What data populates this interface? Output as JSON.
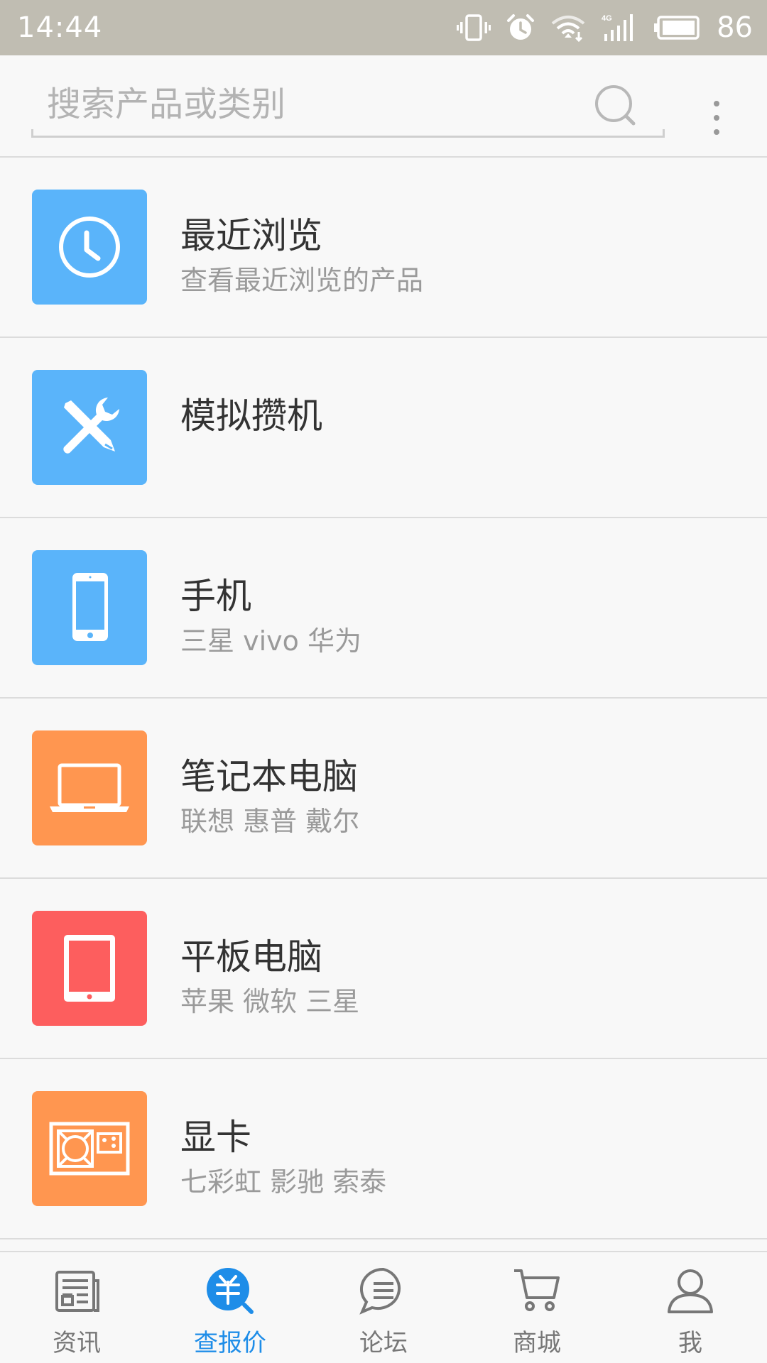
{
  "status_bar": {
    "time": "14:44",
    "battery": "86",
    "network": "4G"
  },
  "search": {
    "placeholder": "搜索产品或类别"
  },
  "list": [
    {
      "title": "最近浏览",
      "subtitle": "查看最近浏览的产品",
      "icon": "clock-icon",
      "color": "#5ab4fa"
    },
    {
      "title": "模拟攒机",
      "subtitle": "",
      "icon": "tools-icon",
      "color": "#5ab4fa"
    },
    {
      "title": "手机",
      "subtitle": "三星  vivo  华为",
      "icon": "phone-icon",
      "color": "#5ab4fa"
    },
    {
      "title": "笔记本电脑",
      "subtitle": "联想  惠普  戴尔",
      "icon": "laptop-icon",
      "color": "#ff9650"
    },
    {
      "title": "平板电脑",
      "subtitle": "苹果  微软  三星",
      "icon": "tablet-icon",
      "color": "#fd5e5e"
    },
    {
      "title": "显卡",
      "subtitle": "七彩虹  影驰  索泰",
      "icon": "graphics-card-icon",
      "color": "#ff9650"
    }
  ],
  "bottom_nav": {
    "active_color": "#1e8de8",
    "items": [
      {
        "label": "资讯",
        "icon": "news-icon"
      },
      {
        "label": "查报价",
        "icon": "price-icon"
      },
      {
        "label": "论坛",
        "icon": "forum-icon"
      },
      {
        "label": "商城",
        "icon": "cart-icon"
      },
      {
        "label": "我",
        "icon": "user-icon"
      }
    ]
  }
}
